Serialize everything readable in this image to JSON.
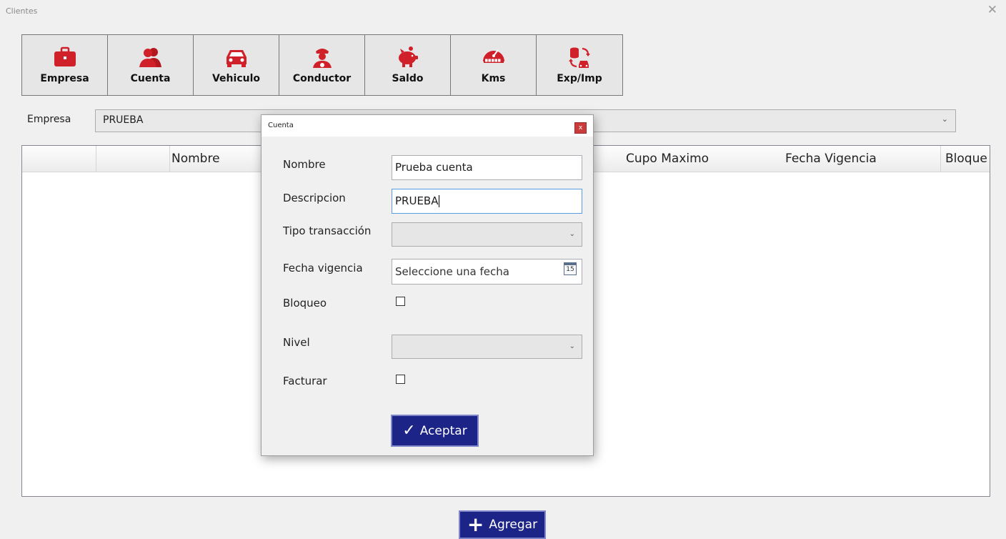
{
  "window": {
    "title": "Clientes",
    "close_glyph": "✕"
  },
  "toolbar": [
    {
      "label": "Empresa",
      "icon": "briefcase-icon"
    },
    {
      "label": "Cuenta",
      "icon": "users-icon"
    },
    {
      "label": "Vehiculo",
      "icon": "car-icon"
    },
    {
      "label": "Conductor",
      "icon": "driver-icon"
    },
    {
      "label": "Saldo",
      "icon": "piggy-bank-icon"
    },
    {
      "label": "Kms",
      "icon": "odometer-icon"
    },
    {
      "label": "Exp/Imp",
      "icon": "export-import-icon"
    }
  ],
  "empresa": {
    "label": "Empresa",
    "value": "PRUEBA"
  },
  "grid": {
    "columns": [
      "Nombre",
      "Cupo Maximo",
      "Fecha Vigencia",
      "Bloque"
    ]
  },
  "add_button": {
    "label": "Agregar"
  },
  "dialog": {
    "title": "Cuenta",
    "close_glyph": "x",
    "fields": {
      "nombre": {
        "label": "Nombre",
        "value": "Prueba cuenta"
      },
      "descripcion": {
        "label": "Descripcion",
        "value": "PRUEBA"
      },
      "tipo_transaccion": {
        "label": "Tipo transacción",
        "value": ""
      },
      "fecha_vigencia": {
        "label": "Fecha vigencia",
        "placeholder": "Seleccione una fecha",
        "calendar_day": "15"
      },
      "bloqueo": {
        "label": "Bloqueo",
        "checked": false
      },
      "nivel": {
        "label": "Nivel",
        "value": ""
      },
      "facturar": {
        "label": "Facturar",
        "checked": false
      }
    },
    "accept_label": "Aceptar"
  },
  "colors": {
    "accent_red": "#d0202a",
    "button_navy": "#1c2487"
  }
}
